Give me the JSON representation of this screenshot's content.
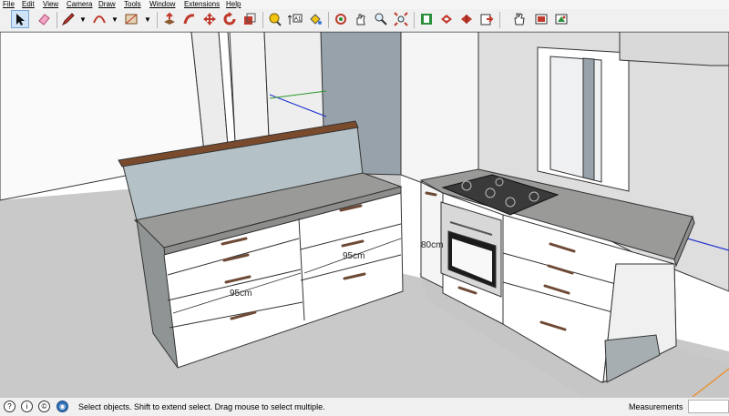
{
  "menu": [
    "File",
    "Edit",
    "View",
    "Camera",
    "Draw",
    "Tools",
    "Window",
    "Extensions",
    "Help"
  ],
  "toolbar": {
    "tools": [
      "select-icon",
      "eraser-icon",
      "pencil-icon",
      "arc-icon",
      "rectangle-icon",
      "push-pull-icon",
      "follow-me-icon",
      "move-icon",
      "rotate-icon",
      "scale-icon",
      "tape-measure-icon",
      "dimension-icon",
      "paint-bucket-icon",
      "orbit-icon",
      "pan-icon",
      "zoom-icon",
      "zoom-extents-icon",
      "warehouse-icon",
      "extension-warehouse-icon",
      "share-model-icon",
      "send-to-layout-icon",
      "hand-icon",
      "layer-icon",
      "styles-icon"
    ]
  },
  "viewport": {
    "dimensions": {
      "left_depth": "95cm",
      "right_depth": "95cm",
      "side": "80cm"
    }
  },
  "status": {
    "text": "Select objects. Shift to extend select. Drag mouse to select multiple.",
    "measurements_label": "Measurements",
    "measurements_value": ""
  },
  "colors": {
    "accent": "#2277cc",
    "wall": "#ffffff",
    "floor": "#c9c9c9",
    "worktop": "#9a9a98"
  }
}
